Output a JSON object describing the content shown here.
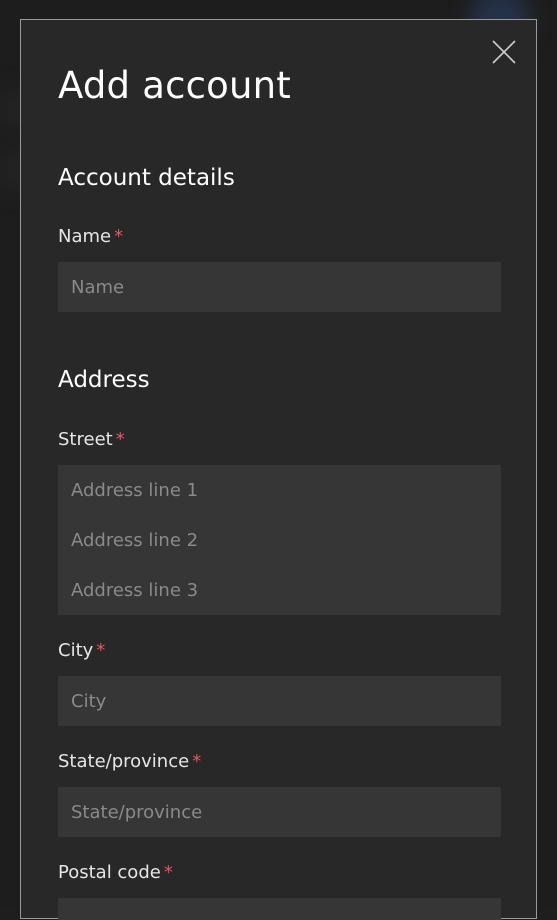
{
  "dialog": {
    "title": "Add account",
    "close_icon": "close-icon"
  },
  "account_details": {
    "heading": "Account details",
    "name": {
      "label": "Name",
      "required_marker": "*",
      "placeholder": "Name",
      "value": ""
    }
  },
  "address": {
    "heading": "Address",
    "street": {
      "label": "Street",
      "required_marker": "*",
      "lines": [
        {
          "placeholder": "Address line 1",
          "value": ""
        },
        {
          "placeholder": "Address line 2",
          "value": ""
        },
        {
          "placeholder": "Address line 3",
          "value": ""
        }
      ]
    },
    "city": {
      "label": "City",
      "required_marker": "*",
      "placeholder": "City",
      "value": ""
    },
    "state": {
      "label": "State/province",
      "required_marker": "*",
      "placeholder": "State/province",
      "value": ""
    },
    "postal_code": {
      "label": "Postal code",
      "required_marker": "*",
      "placeholder": "",
      "value": ""
    }
  },
  "colors": {
    "background": "#1d1d1d",
    "dialog_bg": "#282828",
    "input_bg": "#363636",
    "required": "#e8555d",
    "text": "#ffffff",
    "placeholder": "#8a8a8a"
  }
}
